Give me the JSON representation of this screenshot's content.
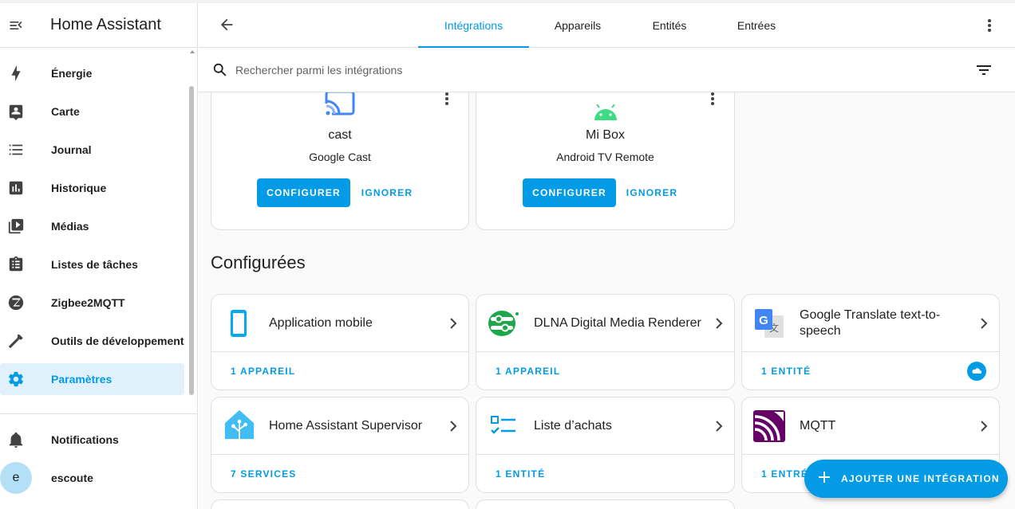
{
  "app": {
    "title": "Home Assistant"
  },
  "sidebar": {
    "items": [
      {
        "label": "Énergie",
        "icon": "lightning-icon"
      },
      {
        "label": "Carte",
        "icon": "map-account-icon"
      },
      {
        "label": "Journal",
        "icon": "list-icon"
      },
      {
        "label": "Historique",
        "icon": "chart-box-icon"
      },
      {
        "label": "Médias",
        "icon": "play-box-multiple-icon"
      },
      {
        "label": "Listes de tâches",
        "icon": "clipboard-list-icon"
      },
      {
        "label": "Zigbee2MQTT",
        "icon": "zigbee-icon"
      },
      {
        "label": "Outils de développement",
        "icon": "hammer-icon"
      },
      {
        "label": "Paramètres",
        "icon": "gear-icon",
        "active": true
      }
    ],
    "notifications": "Notifications",
    "user": {
      "initial": "e",
      "name": "escoute"
    }
  },
  "tabs": [
    {
      "label": "Intégrations",
      "active": true
    },
    {
      "label": "Appareils"
    },
    {
      "label": "Entités"
    },
    {
      "label": "Entrées"
    }
  ],
  "search": {
    "placeholder": "Rechercher parmi les intégrations",
    "value": ""
  },
  "discovered": [
    {
      "name": "cast",
      "subtitle": "Google Cast",
      "configure": "CONFIGURER",
      "ignore": "IGNORER",
      "icon": "cast-icon"
    },
    {
      "name": "Mi Box",
      "subtitle": "Android TV Remote",
      "configure": "CONFIGURER",
      "ignore": "IGNORER",
      "icon": "android-icon"
    }
  ],
  "section": {
    "configured_title": "Configurées"
  },
  "integrations": [
    {
      "title": "Application mobile",
      "footer": "1 APPAREIL",
      "icon": "cellphone-icon"
    },
    {
      "title": "DLNA Digital Media Renderer",
      "footer": "1 APPAREIL",
      "icon": "dlna-icon"
    },
    {
      "title": "Google Translate text-to-speech",
      "footer": "1 ENTITÉ",
      "icon": "google-translate-icon",
      "cloud": true
    },
    {
      "title": "Home Assistant Supervisor",
      "footer": "7 SERVICES",
      "icon": "home-assistant-icon"
    },
    {
      "title": "Liste d’achats",
      "footer": "1 ENTITÉ",
      "icon": "checklist-icon"
    },
    {
      "title": "MQTT",
      "footer": "1 ENTRÉE",
      "icon": "mqtt-icon"
    }
  ],
  "fab": {
    "label": "AJOUTER UNE INTÉGRATION"
  },
  "colors": {
    "accent": "#039be5",
    "sidebar_active_bg": "#e1f1fb",
    "mqtt": "#660066",
    "dlna": "#1fa64a",
    "android": "#3ddc84"
  }
}
